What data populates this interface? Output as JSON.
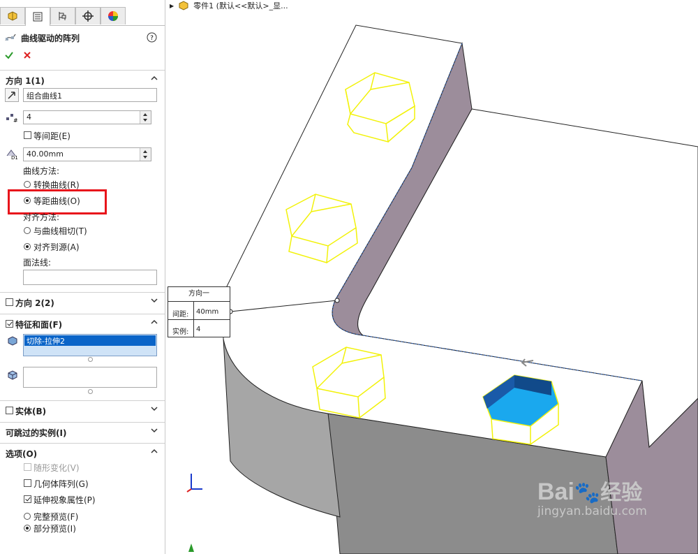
{
  "tabs": [
    {
      "icon": "feature-manager-icon"
    },
    {
      "icon": "property-manager-icon"
    },
    {
      "icon": "configuration-manager-icon"
    },
    {
      "icon": "dimxpert-icon"
    },
    {
      "icon": "display-manager-icon"
    }
  ],
  "property_title": "曲线驱动的阵列",
  "direction1": {
    "header": "方向 1(1)",
    "curve_value": "组合曲线1",
    "instances_value": "4",
    "equal_spacing_label": "等间距(E)",
    "spacing_value": "40.00mm",
    "curve_method_label": "曲线方法:",
    "transform_curve_label": "转换曲线(R)",
    "offset_curve_label": "等距曲线(O)",
    "align_method_label": "对齐方法:",
    "tangent_label": "与曲线相切(T)",
    "align_origin_label": "对齐到源(A)",
    "normal_label": "面法线:",
    "normal_value": ""
  },
  "direction2": {
    "header": "方向 2(2)"
  },
  "features": {
    "header": "特征和面(F)",
    "selected_item": "切除-拉伸2",
    "faces_value": ""
  },
  "bodies": {
    "header": "实体(B)"
  },
  "skip": {
    "header": "可跳过的实例(I)"
  },
  "options": {
    "header": "选项(O)",
    "vary_sketch_label": "随形变化(V)",
    "geometry_pattern_label": "几何体阵列(G)",
    "propagate_label": "延伸视象属性(P)",
    "full_preview_label": "完整预览(F)",
    "partial_preview_label": "部分预览(I)"
  },
  "tree_path": "零件1  (默认<<默认>_显...",
  "callout": {
    "title": "方向一",
    "spacing_label": "间距:",
    "spacing_value": "40mm",
    "instances_label": "实例:",
    "instances_value": "4"
  },
  "watermark": {
    "brand": "Bai",
    "brand2": "经验",
    "url": "jingyan.baidu.com"
  },
  "colors": {
    "highlight_red": "#e8141b",
    "selection_blue": "#0a64c8",
    "preview_yellow": "#f2f20a",
    "hex_blue": "#1aa8ee",
    "wall_purple": "#9c8d9b",
    "wall_gray": "#8c8c8c"
  }
}
